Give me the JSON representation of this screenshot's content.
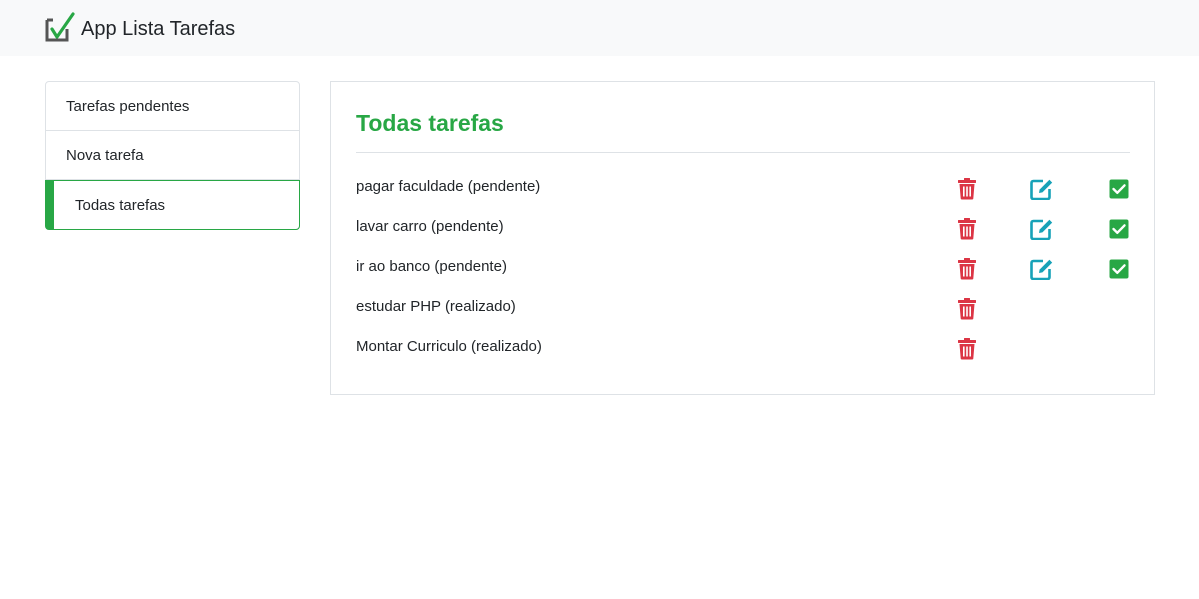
{
  "app": {
    "title": "App Lista Tarefas",
    "brand_color": "#28a745"
  },
  "sidebar": {
    "items": [
      {
        "label": "Tarefas pendentes",
        "active": false
      },
      {
        "label": "Nova tarefa",
        "active": false
      },
      {
        "label": "Todas tarefas",
        "active": true
      }
    ]
  },
  "main": {
    "title": "Todas tarefas",
    "tasks": [
      {
        "text": "pagar faculdade (pendente)",
        "actions": [
          "trash-icon",
          "edit-icon",
          "check-icon"
        ]
      },
      {
        "text": "lavar carro (pendente)",
        "actions": [
          "trash-icon",
          "edit-icon",
          "check-icon"
        ]
      },
      {
        "text": "ir ao banco (pendente)",
        "actions": [
          "trash-icon",
          "edit-icon",
          "check-icon"
        ]
      },
      {
        "text": "estudar PHP (realizado)",
        "actions": [
          "trash-icon"
        ]
      },
      {
        "text": "Montar Curriculo (realizado)",
        "actions": [
          "trash-icon"
        ]
      }
    ]
  },
  "colors": {
    "delete": "#dc3545",
    "edit": "#17a2b8",
    "done": "#28a745"
  }
}
